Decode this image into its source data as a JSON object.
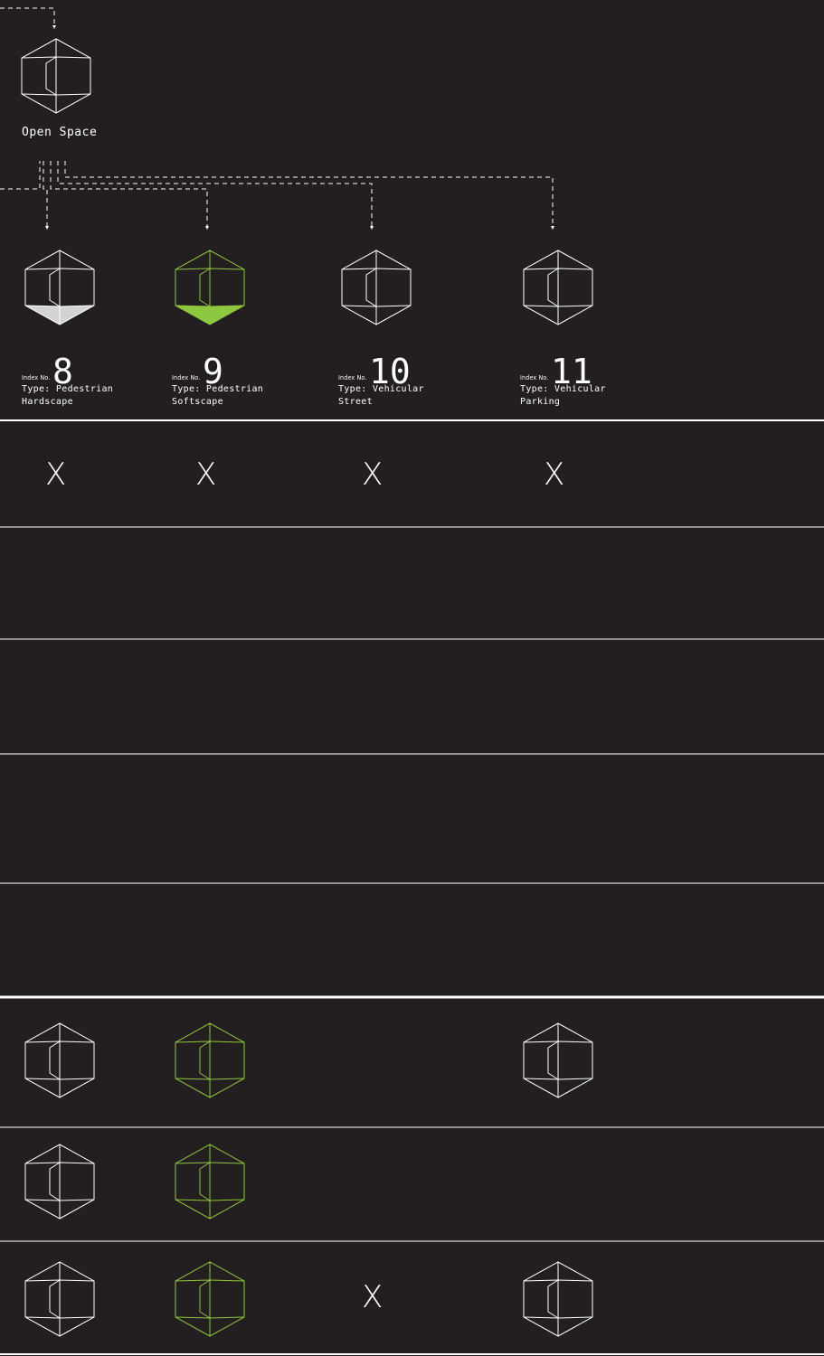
{
  "colors": {
    "background": "#231f20",
    "line": "#ffffff",
    "green": "#8dc63f",
    "hardscape_fill": "#d1d3d4"
  },
  "parent": {
    "label": "Open Space",
    "icon": "cube-icon"
  },
  "types": [
    {
      "prefix": "Index No.",
      "index": "8",
      "line1": "Type: Pedestrian",
      "line2": "Hardscape",
      "icon": "cube-hardscape-icon"
    },
    {
      "prefix": "Index No.",
      "index": "9",
      "line1": "Type: Pedestrian",
      "line2": "Softscape",
      "icon": "cube-softscape-icon"
    },
    {
      "prefix": "Index No.",
      "index": "10",
      "line1": "Type: Vehicular",
      "line2": "Street",
      "icon": "cube-icon"
    },
    {
      "prefix": "Index No.",
      "index": "11",
      "line1": "Type: Vehicular",
      "line2": "Parking",
      "icon": "cube-icon"
    }
  ],
  "matrix": {
    "mark": "X",
    "rows": [
      [
        "x",
        "x",
        "x",
        "x"
      ],
      [
        "",
        "",
        "",
        ""
      ],
      [
        "",
        "",
        "",
        ""
      ],
      [
        "",
        "",
        "",
        ""
      ],
      [
        "",
        "",
        "",
        ""
      ],
      [
        "cube",
        "cube-green",
        "",
        "cube"
      ],
      [
        "cube",
        "cube-green",
        "",
        ""
      ],
      [
        "cube",
        "cube-green",
        "x",
        "cube"
      ]
    ]
  }
}
